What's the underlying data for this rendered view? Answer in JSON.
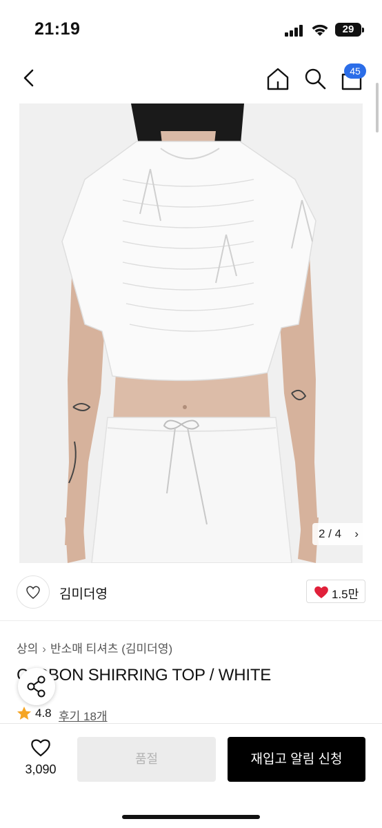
{
  "status_bar": {
    "time": "21:19",
    "battery": "29"
  },
  "nav": {
    "cart_count": "45"
  },
  "gallery": {
    "page_indicator": "2 / 4",
    "current_page": 2,
    "total_pages": 4
  },
  "brand": {
    "name": "김미더영",
    "likes": "1.5만"
  },
  "breadcrumb": {
    "category": "상의",
    "subcategory": "반소매 티셔츠 (김미더영)"
  },
  "product": {
    "title": "C... RIBBON SHIRRING TOP / WHITE",
    "title_visible": "C   IBBON SHIRRING TOP / WHITE"
  },
  "rating": {
    "score": "4.8",
    "reviews_label": "후기 18개"
  },
  "bottom_bar": {
    "wish_count": "3,090",
    "soldout_label": "품절",
    "restock_label": "재입고 알림 신청"
  },
  "colors": {
    "accent": "#2b6de8",
    "heart": "#e0203a",
    "star": "#f5a524",
    "primary_button": "#000000"
  },
  "icons": [
    "back-arrow-icon",
    "home-icon",
    "search-icon",
    "cart-icon",
    "chevron-right-icon",
    "heart-icon",
    "share-icon",
    "star-icon"
  ]
}
